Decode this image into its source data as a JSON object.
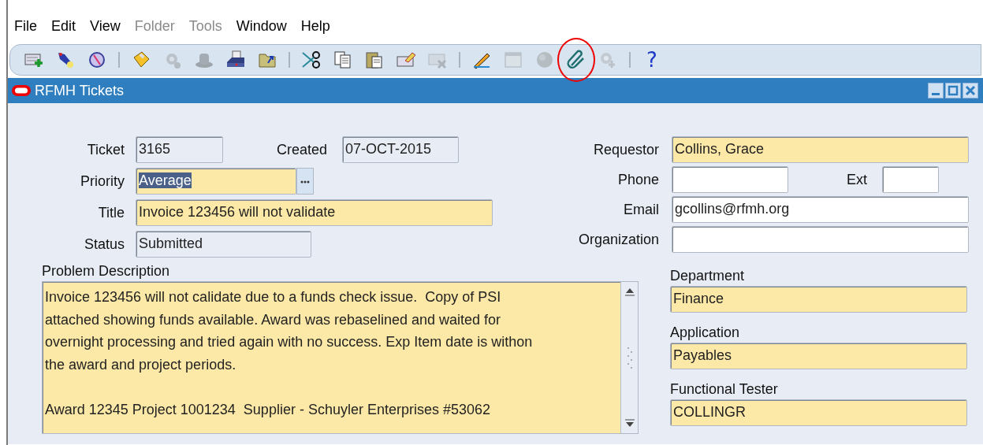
{
  "menu": [
    {
      "label": "File",
      "disabled": false
    },
    {
      "label": "Edit",
      "disabled": false
    },
    {
      "label": "View",
      "disabled": false
    },
    {
      "label": "Folder",
      "disabled": true
    },
    {
      "label": "Tools",
      "disabled": true
    },
    {
      "label": "Window",
      "disabled": false
    },
    {
      "label": "Help",
      "disabled": false
    }
  ],
  "toolbar": {
    "items": [
      {
        "kind": "button",
        "disabled": false
      },
      {
        "kind": "button",
        "disabled": false
      },
      {
        "kind": "button",
        "disabled": false
      },
      {
        "kind": "separator"
      },
      {
        "kind": "button",
        "disabled": false
      },
      {
        "kind": "button",
        "disabled": true
      },
      {
        "kind": "button",
        "disabled": true
      },
      {
        "kind": "button",
        "disabled": false
      },
      {
        "kind": "button",
        "disabled": false
      },
      {
        "kind": "separator"
      },
      {
        "kind": "button",
        "disabled": false
      },
      {
        "kind": "button",
        "disabled": false
      },
      {
        "kind": "button",
        "disabled": false
      },
      {
        "kind": "button",
        "disabled": false
      },
      {
        "kind": "button",
        "disabled": true
      },
      {
        "kind": "separator"
      },
      {
        "kind": "button",
        "disabled": false
      },
      {
        "kind": "button",
        "disabled": true
      },
      {
        "kind": "button",
        "disabled": true
      },
      {
        "kind": "button",
        "disabled": false,
        "highlighted": true
      },
      {
        "kind": "button",
        "disabled": true
      },
      {
        "kind": "separator"
      },
      {
        "kind": "text",
        "label": "?"
      }
    ]
  },
  "window": {
    "title": "RFMH Tickets"
  },
  "form": {
    "left": [
      {
        "label": "Ticket",
        "value": "3165",
        "kind": "readonly"
      },
      {
        "label": "Created",
        "value": "07-OCT-2015",
        "kind": "readonly"
      },
      {
        "label": "Priority",
        "value": "Average",
        "kind": "required",
        "selected": true,
        "lov": true
      },
      {
        "label": "Title",
        "value": "Invoice 123456 will not validate",
        "kind": "required"
      },
      {
        "label": "Status",
        "value": "Submitted",
        "kind": "readonly"
      }
    ],
    "right": [
      {
        "label": "Requestor",
        "value": "Collins, Grace",
        "kind": "required"
      },
      {
        "label": "Phone",
        "kind": "optional"
      },
      {
        "label": "Ext",
        "kind": "optional"
      },
      {
        "label": "Email",
        "value": "gcollins@rfmh.org",
        "kind": "optional"
      },
      {
        "label": "Organization",
        "kind": "optional"
      }
    ],
    "description": {
      "label": "Problem Description",
      "value": "Invoice 123456 will not calidate due to a funds check issue.  Copy of PSI\nattached showing funds available. Award was rebaselined and waited for\novernight processing and tried again with no success. Exp Item date is withon\nthe award and project periods.\n\nAward 12345 Project 1001234  Supplier - Schuyler Enterprises #53062",
      "kind": "required"
    },
    "side": [
      {
        "label": "Department",
        "value": "Finance",
        "kind": "required"
      },
      {
        "label": "Application",
        "value": "Payables",
        "kind": "required"
      },
      {
        "label": "Functional Tester",
        "value": "COLLINGR",
        "kind": "required"
      }
    ]
  }
}
